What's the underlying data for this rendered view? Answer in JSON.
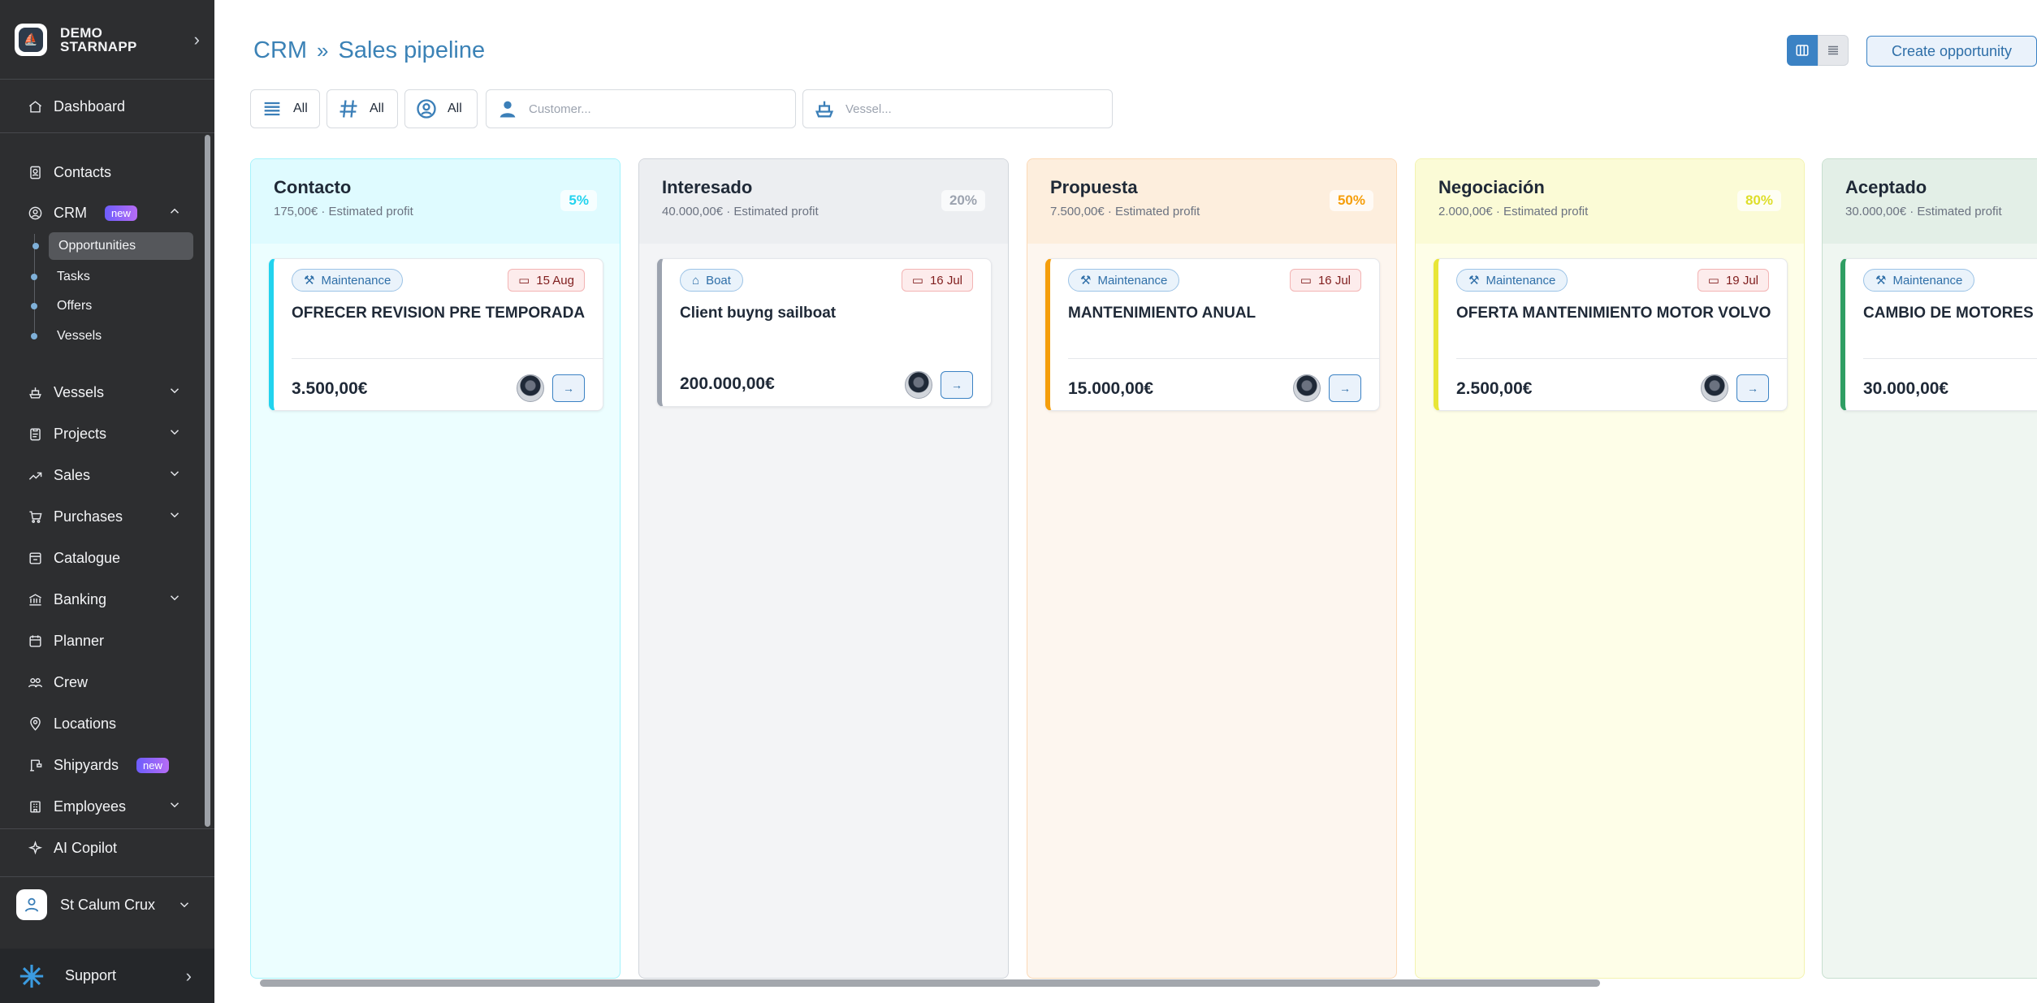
{
  "sidebar": {
    "brand": "DEMO STARNAPP",
    "items": [
      {
        "label": "Dashboard"
      },
      {
        "label": "Contacts"
      },
      {
        "label": "CRM",
        "badge": "new"
      },
      {
        "label": "Vessels"
      },
      {
        "label": "Projects"
      },
      {
        "label": "Sales"
      },
      {
        "label": "Purchases"
      },
      {
        "label": "Catalogue"
      },
      {
        "label": "Banking"
      },
      {
        "label": "Planner"
      },
      {
        "label": "Crew"
      },
      {
        "label": "Locations"
      },
      {
        "label": "Shipyards",
        "badge": "new"
      },
      {
        "label": "Employees"
      }
    ],
    "crm_sub": [
      "Opportunities",
      "Tasks",
      "Offers",
      "Vessels"
    ],
    "ai_copilot": "AI Copilot",
    "user": "St Calum Crux",
    "support": "Support"
  },
  "header": {
    "crumb1": "CRM",
    "crumb_sep": "»",
    "crumb2": "Sales pipeline",
    "create_button": "Create opportunity"
  },
  "filters": {
    "f1": "All",
    "f2": "All",
    "f3": "All",
    "customer_placeholder": "Customer...",
    "vessel_placeholder": "Vessel..."
  },
  "columns": [
    {
      "name": "Contacto",
      "profit": "175,00€ · Estimated profit",
      "pct": "5%",
      "color": "#22d3ee",
      "card": {
        "tag": "Maintenance",
        "date": "15 Aug",
        "title": "OFRECER REVISION PRE TEMPORADA",
        "amount": "3.500,00€"
      }
    },
    {
      "name": "Interesado",
      "profit": "40.000,00€ · Estimated profit",
      "pct": "20%",
      "color": "#9ca3af",
      "card": {
        "tag": "Boat",
        "date": "16 Jul",
        "title": "Client buyng sailboat",
        "amount": "200.000,00€"
      }
    },
    {
      "name": "Propuesta",
      "profit": "7.500,00€ · Estimated profit",
      "pct": "50%",
      "color": "#f59e0b",
      "card": {
        "tag": "Maintenance",
        "date": "16 Jul",
        "title": "MANTENIMIENTO ANUAL",
        "amount": "15.000,00€"
      }
    },
    {
      "name": "Negociación",
      "profit": "2.000,00€ · Estimated profit",
      "pct": "80%",
      "color": "#e8e637",
      "card": {
        "tag": "Maintenance",
        "date": "19 Jul",
        "title": "OFERTA MANTENIMIENTO MOTOR VOLVO",
        "amount": "2.500,00€"
      }
    },
    {
      "name": "Aceptado",
      "profit": "30.000,00€ · Estimated profit",
      "pct": "",
      "color": "#2f9e63",
      "card": {
        "tag": "Maintenance",
        "date": "",
        "title": "CAMBIO DE MOTORES",
        "amount": "30.000,00€"
      }
    }
  ]
}
